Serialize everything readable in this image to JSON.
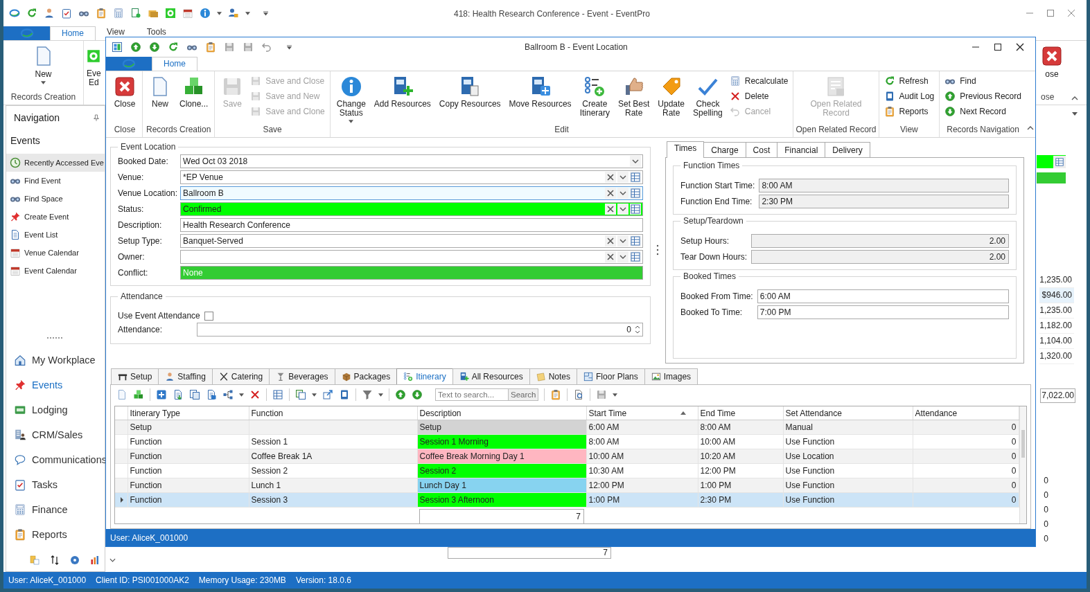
{
  "main_window": {
    "title": "418: Health Research Conference - Event - EventPro",
    "ribbon_tabs": [
      {
        "label": "Home",
        "selected": true
      },
      {
        "label": "View",
        "selected": false
      },
      {
        "label": "Tools",
        "selected": false
      }
    ],
    "ribbon_new": {
      "label": "New",
      "group": "Records Creation"
    },
    "ribbon_event_edit": {
      "label": "Eve\nEd"
    },
    "ribbon_close": {
      "label": "ose",
      "group": "ose"
    },
    "navigation": {
      "title": "Navigation",
      "section": "Events",
      "items": [
        {
          "label": "Recently Accessed Eve",
          "selected": true
        },
        {
          "label": "Find Event",
          "selected": false
        },
        {
          "label": "Find Space",
          "selected": false
        },
        {
          "label": "Create Event",
          "selected": false
        },
        {
          "label": "Event List",
          "selected": false
        },
        {
          "label": "Venue Calendar",
          "selected": false
        },
        {
          "label": "Event Calendar",
          "selected": false
        }
      ],
      "modules": [
        {
          "label": "My Workplace",
          "selected": false
        },
        {
          "label": "Events",
          "selected": true
        },
        {
          "label": "Lodging",
          "selected": false
        },
        {
          "label": "CRM/Sales",
          "selected": false
        },
        {
          "label": "Communications",
          "selected": false
        },
        {
          "label": "Tasks",
          "selected": false
        },
        {
          "label": "Finance",
          "selected": false
        },
        {
          "label": "Reports",
          "selected": false
        }
      ]
    },
    "background_amounts": [
      {
        "value": "1,235.00",
        "selected": false
      },
      {
        "value": "$946.00",
        "selected": true
      },
      {
        "value": "1,235.00",
        "selected": false
      },
      {
        "value": "1,182.00",
        "selected": false
      },
      {
        "value": "1,104.00",
        "selected": false
      },
      {
        "value": "1,320.00",
        "selected": false
      }
    ],
    "background_total": "7,022.00",
    "background_counts": [
      "0",
      "0",
      "0",
      "0",
      "0"
    ],
    "background_footer": "7",
    "status_bar": [
      "User: AliceK_001000",
      "Client ID: PSI001000AK2",
      "Memory Usage: 230MB",
      "Version: 18.0.6"
    ]
  },
  "dialog": {
    "title": "Ballroom B - Event Location",
    "ribbon_tabs": [
      {
        "label": "Home",
        "selected": true
      }
    ],
    "ribbon_groups": [
      {
        "label": "Close",
        "items": [
          {
            "kind": "large",
            "label": "Close",
            "disabled": false,
            "dropdown": false
          }
        ]
      },
      {
        "label": "Records Creation",
        "items": [
          {
            "kind": "large",
            "label": "New",
            "disabled": false,
            "dropdown": false
          },
          {
            "kind": "large",
            "label": "Clone...",
            "disabled": false,
            "dropdown": false
          }
        ]
      },
      {
        "label": "Save",
        "items": [
          {
            "kind": "large",
            "label": "Save",
            "disabled": true,
            "dropdown": false
          },
          {
            "kind": "small",
            "label": "Save and Close",
            "disabled": true
          },
          {
            "kind": "small",
            "label": "Save and New",
            "disabled": true
          },
          {
            "kind": "small",
            "label": "Save and Clone",
            "disabled": true
          }
        ]
      },
      {
        "label": "Edit",
        "items": [
          {
            "kind": "large",
            "label": "Change\nStatus",
            "disabled": false,
            "dropdown": true
          },
          {
            "kind": "large",
            "label": "Add Resources",
            "disabled": false,
            "dropdown": false
          },
          {
            "kind": "large",
            "label": "Copy Resources",
            "disabled": false,
            "dropdown": false
          },
          {
            "kind": "large",
            "label": "Move Resources",
            "disabled": false,
            "dropdown": false
          },
          {
            "kind": "large",
            "label": "Create\nItinerary",
            "disabled": false,
            "dropdown": false
          },
          {
            "kind": "large",
            "label": "Set Best\nRate",
            "disabled": false,
            "dropdown": false
          },
          {
            "kind": "large",
            "label": "Update\nRate",
            "disabled": false,
            "dropdown": false
          },
          {
            "kind": "large",
            "label": "Check\nSpelling",
            "disabled": false,
            "dropdown": false
          },
          {
            "kind": "small",
            "label": "Recalculate",
            "disabled": false
          },
          {
            "kind": "small",
            "label": "Delete",
            "disabled": false
          },
          {
            "kind": "small",
            "label": "Cancel",
            "disabled": true
          }
        ]
      },
      {
        "label": "Open Related Record",
        "items": [
          {
            "kind": "large",
            "label": "Open Related\nRecord",
            "disabled": true,
            "dropdown": false
          }
        ]
      },
      {
        "label": "View",
        "items": [
          {
            "kind": "small",
            "label": "Refresh",
            "disabled": false
          },
          {
            "kind": "small",
            "label": "Audit Log",
            "disabled": false
          },
          {
            "kind": "small",
            "label": "Reports",
            "disabled": false
          }
        ]
      },
      {
        "label": "Records Navigation",
        "items": [
          {
            "kind": "small",
            "label": "Find",
            "disabled": false
          },
          {
            "kind": "small",
            "label": "Previous Record",
            "disabled": false
          },
          {
            "kind": "small",
            "label": "Next Record",
            "disabled": false
          }
        ]
      }
    ],
    "event_location": {
      "title": "Event Location",
      "fields": [
        {
          "label": "Booked Date:",
          "value": "Wed Oct 03 2018",
          "kind": "date",
          "focused": false
        },
        {
          "label": "Venue:",
          "value": "*EP Venue",
          "kind": "lookup",
          "focused": false
        },
        {
          "label": "Venue Location:",
          "value": "Ballroom B",
          "kind": "lookup",
          "focused": true
        },
        {
          "label": "Status:",
          "value": "Confirmed",
          "kind": "lookup",
          "focused": false,
          "color": "#00ff00"
        },
        {
          "label": "Description:",
          "value": "Health Research Conference",
          "kind": "text",
          "focused": false
        },
        {
          "label": "Setup Type:",
          "value": "Banquet-Served",
          "kind": "lookup",
          "focused": false
        },
        {
          "label": "Owner:",
          "kind": "lookup",
          "focused": false
        },
        {
          "label": "Conflict:",
          "value": "None",
          "kind": "status",
          "focused": false,
          "color": "#33cc33"
        }
      ]
    },
    "attendance": {
      "title": "Attendance",
      "use_event_attendance": {
        "label": "Use Event Attendance",
        "checked": false
      },
      "attendance": {
        "label": "Attendance:",
        "value": "0"
      }
    },
    "detail_tabs": [
      {
        "label": "Times",
        "selected": true
      },
      {
        "label": "Charge",
        "selected": false
      },
      {
        "label": "Cost",
        "selected": false
      },
      {
        "label": "Financial",
        "selected": false
      },
      {
        "label": "Delivery",
        "selected": false
      }
    ],
    "times_sections": [
      {
        "title": "Function Times",
        "fields": [
          {
            "label": "Function Start Time:",
            "value": "8:00 AM",
            "kind": "time",
            "readonly": true
          },
          {
            "label": "Function End Time:",
            "value": "2:30 PM",
            "kind": "time",
            "readonly": true
          }
        ]
      },
      {
        "title": "Setup/Teardown",
        "fields": [
          {
            "label": "Setup Hours:",
            "value": "2.00",
            "kind": "number",
            "readonly": true
          },
          {
            "label": "Tear Down Hours:",
            "value": "2.00",
            "kind": "number",
            "readonly": true
          }
        ]
      },
      {
        "title": "Booked Times",
        "fields": [
          {
            "label": "Booked From Time:",
            "value": "6:00 AM",
            "kind": "time",
            "readonly": false
          },
          {
            "label": "Booked To Time:",
            "value": "7:00 PM",
            "kind": "time",
            "readonly": false
          }
        ]
      }
    ],
    "bottom_tabs": [
      {
        "label": "Setup",
        "selected": false
      },
      {
        "label": "Staffing",
        "selected": false
      },
      {
        "label": "Catering",
        "selected": false
      },
      {
        "label": "Beverages",
        "selected": false
      },
      {
        "label": "Packages",
        "selected": false
      },
      {
        "label": "Itinerary",
        "selected": true
      },
      {
        "label": "All Resources",
        "selected": false
      },
      {
        "label": "Notes",
        "selected": false
      },
      {
        "label": "Floor Plans",
        "selected": false
      },
      {
        "label": "Images",
        "selected": false
      }
    ],
    "grid_search": {
      "placeholder": "Text to search...",
      "button": "Search"
    },
    "grid": {
      "columns": [
        {
          "label": "Itinerary Type",
          "sorted": false
        },
        {
          "label": "Function",
          "sorted": false
        },
        {
          "label": "Description",
          "sorted": false
        },
        {
          "label": "Start Time",
          "sorted": true
        },
        {
          "label": "End Time",
          "sorted": false
        },
        {
          "label": "Set Attendance",
          "sorted": false
        },
        {
          "label": "Attendance",
          "sorted": false
        }
      ],
      "rows": [
        {
          "itinerary_type": "Setup",
          "description": "Setup",
          "color": "#d3d3d3",
          "start_time": "6:00 AM",
          "end_time": "8:00 AM",
          "set_attendance": "Manual",
          "attendance": "0",
          "selected": false
        },
        {
          "itinerary_type": "Function",
          "function": "Session 1",
          "description": "Session 1 Morning",
          "color": "#00ff00",
          "start_time": "8:00 AM",
          "end_time": "10:00 AM",
          "set_attendance": "Use Function",
          "attendance": "0",
          "selected": false
        },
        {
          "itinerary_type": "Function",
          "function": "Coffee Break 1A",
          "description": "Coffee Break Morning Day 1",
          "color": "#ffb6c1",
          "start_time": "10:00 AM",
          "end_time": "10:20 AM",
          "set_attendance": "Use Location",
          "attendance": "0",
          "selected": false
        },
        {
          "itinerary_type": "Function",
          "function": "Session 2",
          "description": "Session 2",
          "color": "#00ff00",
          "start_time": "10:30 AM",
          "end_time": "12:00 PM",
          "set_attendance": "Use Function",
          "attendance": "0",
          "selected": false
        },
        {
          "itinerary_type": "Function",
          "function": "Lunch 1",
          "description": "Lunch Day 1",
          "color": "#87d3f0",
          "start_time": "12:00 PM",
          "end_time": "1:00 PM",
          "set_attendance": "Use Function",
          "attendance": "0",
          "selected": false
        },
        {
          "itinerary_type": "Function",
          "function": "Session 3",
          "description": "Session 3 Afternoon",
          "color": "#00ff00",
          "start_time": "1:00 PM",
          "end_time": "2:30 PM",
          "set_attendance": "Use Function",
          "attendance": "0",
          "selected": true
        }
      ],
      "footer": "7"
    },
    "status_bar": "User: AliceK_001000"
  }
}
